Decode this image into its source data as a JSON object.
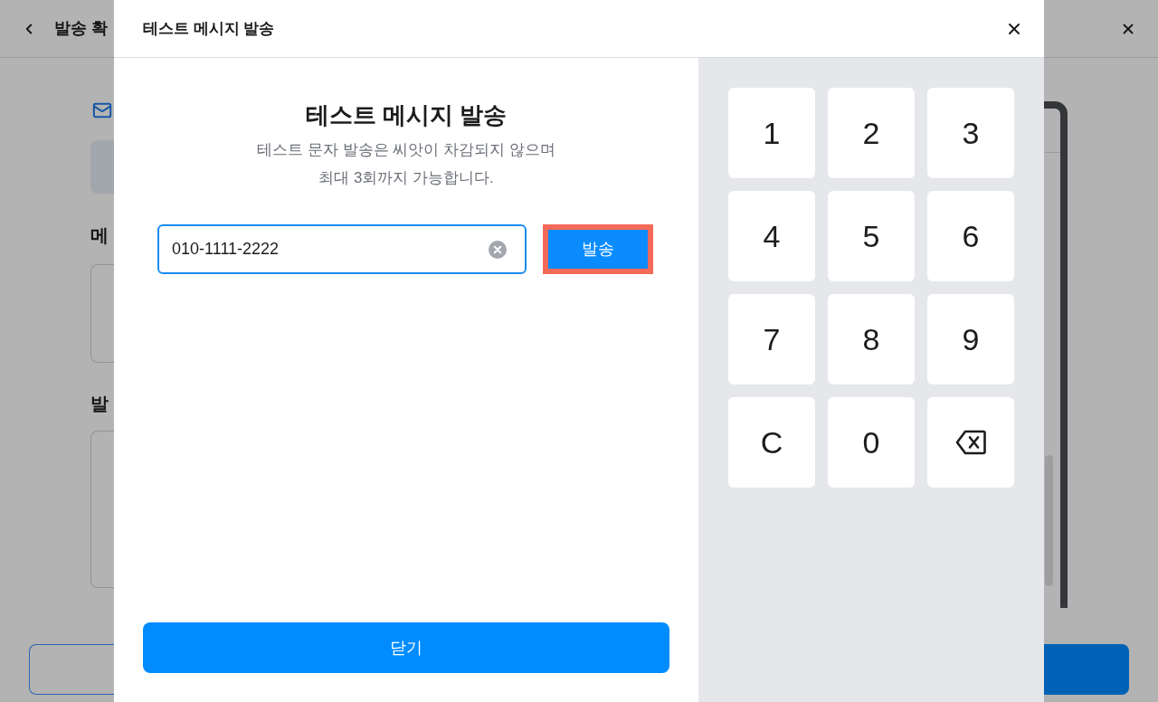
{
  "background_page": {
    "header": {
      "title": "발송 확"
    },
    "sections": [
      {
        "heading": "메"
      },
      {
        "heading": "발"
      }
    ]
  },
  "dialog": {
    "title": "테스트 메시지 발송",
    "heading": "테스트 메시지 발송",
    "description": [
      "테스트 문자 발송은 씨앗이 차감되지 않으며",
      "최대 3회까지 가능합니다."
    ],
    "phone_field": {
      "value": "010-1111-2222",
      "focused": true
    },
    "send_button": {
      "label": "발송",
      "highlighted": true
    },
    "close_button": {
      "label": "닫기"
    },
    "keypad": [
      {
        "kind": "key",
        "label": "1"
      },
      {
        "kind": "key",
        "label": "2"
      },
      {
        "kind": "key",
        "label": "3"
      },
      {
        "kind": "key",
        "label": "4"
      },
      {
        "kind": "key",
        "label": "5"
      },
      {
        "kind": "key",
        "label": "6"
      },
      {
        "kind": "key",
        "label": "7"
      },
      {
        "kind": "key",
        "label": "8"
      },
      {
        "kind": "key",
        "label": "9"
      },
      {
        "kind": "key",
        "label": "C"
      },
      {
        "kind": "key",
        "label": "0"
      },
      {
        "kind": "backspace"
      }
    ]
  }
}
